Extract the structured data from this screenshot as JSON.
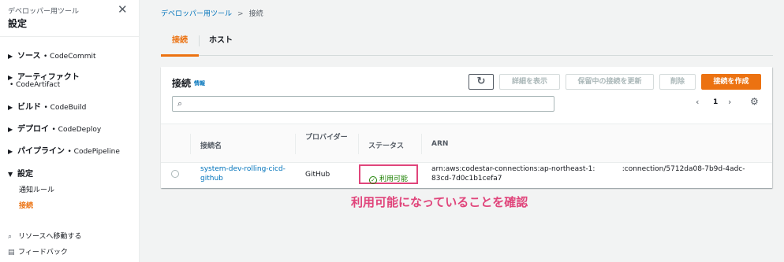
{
  "sidebar": {
    "subtitle": "デベロッパー用ツール",
    "title": "設定",
    "sections": [
      {
        "label": "ソース",
        "service": "• CodeCommit"
      },
      {
        "label": "アーティファクト",
        "service": "• CodeArtifact"
      },
      {
        "label": "ビルド",
        "service": "• CodeBuild"
      },
      {
        "label": "デプロイ",
        "service": "• CodeDeploy"
      },
      {
        "label": "パイプライン",
        "service": "• CodePipeline"
      },
      {
        "label": "設定",
        "service": ""
      }
    ],
    "settings_links": [
      "通知ルール",
      "接続"
    ],
    "footer": [
      "リソースへ移動する",
      "フィードバック"
    ]
  },
  "breadcrumb": {
    "root": "デベロッパー用ツール",
    "current": "接続"
  },
  "tabs": [
    "接続",
    "ホスト"
  ],
  "panel": {
    "title": "接続",
    "info": "情報",
    "buttons": {
      "details": "詳細を表示",
      "update": "保留中の接続を更新",
      "delete": "削除",
      "create": "接続を作成"
    },
    "page": "1",
    "columns": {
      "name": "接続名",
      "provider": "プロバイダー",
      "status": "ステータス",
      "arn": "ARN"
    },
    "rows": [
      {
        "name": "system-dev-rolling-cicd-github",
        "provider": "GitHub",
        "status": "利用可能",
        "arn": "arn:aws:codestar-connections:ap-northeast-1:            :connection/5712da08-7b9d-4adc-\n83cd-7d0c1b1cefa7"
      }
    ]
  },
  "annotation": "利用可能になっていることを確認",
  "colors": {
    "accent": "#ec7211",
    "link": "#0073bb",
    "success": "#1d8102",
    "highlight": "#e0457b"
  }
}
